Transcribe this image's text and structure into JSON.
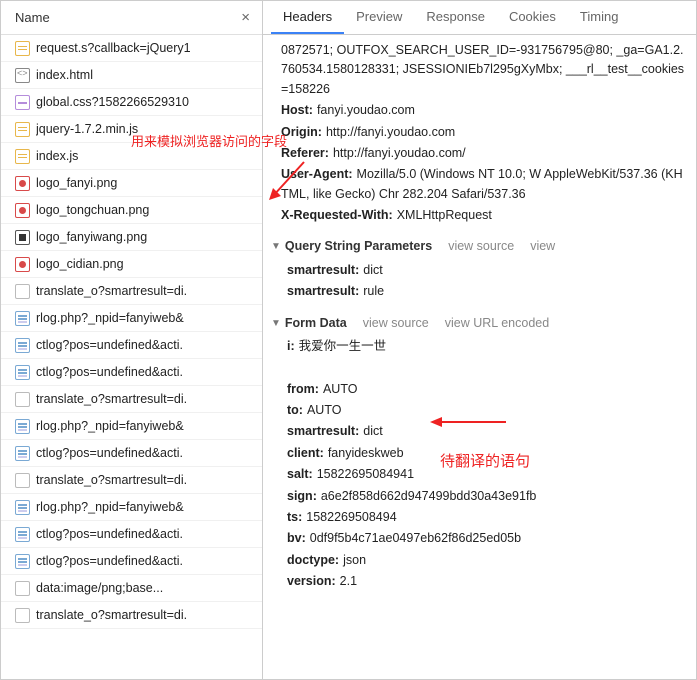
{
  "leftHeader": {
    "title": "Name"
  },
  "files": [
    {
      "icon": "js",
      "name": "request.s?callback=jQuery1"
    },
    {
      "icon": "html",
      "name": "index.html"
    },
    {
      "icon": "css",
      "name": "global.css?1582266529310"
    },
    {
      "icon": "js",
      "name": "jquery-1.7.2.min.js"
    },
    {
      "icon": "js",
      "name": "index.js"
    },
    {
      "icon": "png-r",
      "name": "logo_fanyi.png"
    },
    {
      "icon": "png-r",
      "name": "logo_tongchuan.png"
    },
    {
      "icon": "png-b",
      "name": "logo_fanyiwang.png"
    },
    {
      "icon": "png-r",
      "name": "logo_cidian.png"
    },
    {
      "icon": "plain",
      "name": "translate_o?smartresult=di."
    },
    {
      "icon": "net",
      "name": "rlog.php?_npid=fanyiweb&"
    },
    {
      "icon": "net",
      "name": "ctlog?pos=undefined&acti."
    },
    {
      "icon": "net",
      "name": "ctlog?pos=undefined&acti."
    },
    {
      "icon": "plain",
      "name": "translate_o?smartresult=di."
    },
    {
      "icon": "net",
      "name": "rlog.php?_npid=fanyiweb&"
    },
    {
      "icon": "net",
      "name": "ctlog?pos=undefined&acti."
    },
    {
      "icon": "plain",
      "name": "translate_o?smartresult=di."
    },
    {
      "icon": "net",
      "name": "rlog.php?_npid=fanyiweb&"
    },
    {
      "icon": "net",
      "name": "ctlog?pos=undefined&acti."
    },
    {
      "icon": "net",
      "name": "ctlog?pos=undefined&acti."
    },
    {
      "icon": "plain",
      "name": "data:image/png;base..."
    },
    {
      "icon": "plain",
      "name": "translate_o?smartresult=di."
    }
  ],
  "tabs": [
    {
      "label": "Headers",
      "active": true
    },
    {
      "label": "Preview",
      "active": false
    },
    {
      "label": "Response",
      "active": false
    },
    {
      "label": "Cookies",
      "active": false
    },
    {
      "label": "Timing",
      "active": false
    }
  ],
  "headers": {
    "cookieLine": "0872571; OUTFOX_SEARCH_USER_ID=-931756795@80; _ga=GA1.2.760534.1580128331; JSESSIONIEb7l295gXyMbx; ___rl__test__cookies=158226",
    "items": [
      {
        "k": "Host:",
        "v": "fanyi.youdao.com"
      },
      {
        "k": "Origin:",
        "v": "http://fanyi.youdao.com"
      },
      {
        "k": "Referer:",
        "v": "http://fanyi.youdao.com/"
      },
      {
        "k": "User-Agent:",
        "v": "Mozilla/5.0 (Windows NT 10.0; W AppleWebKit/537.36 (KHTML, like Gecko) Chr 282.204 Safari/537.36"
      },
      {
        "k": "X-Requested-With:",
        "v": "XMLHttpRequest"
      }
    ]
  },
  "query": {
    "title": "Query String Parameters",
    "viewSource": "view source",
    "viewEnc": "view",
    "items": [
      {
        "k": "smartresult:",
        "v": "dict"
      },
      {
        "k": "smartresult:",
        "v": "rule"
      }
    ]
  },
  "form": {
    "title": "Form Data",
    "viewSource": "view source",
    "viewEnc": "view URL encoded",
    "items": [
      {
        "k": "i:",
        "v": "我爱你一生一世"
      },
      {
        "k": "",
        "v": ""
      },
      {
        "k": "from:",
        "v": "AUTO"
      },
      {
        "k": "to:",
        "v": "AUTO"
      },
      {
        "k": "smartresult:",
        "v": "dict"
      },
      {
        "k": "client:",
        "v": "fanyideskweb"
      },
      {
        "k": "salt:",
        "v": "15822695084941"
      },
      {
        "k": "sign:",
        "v": "a6e2f858d662d947499bdd30a43e91fb"
      },
      {
        "k": "ts:",
        "v": "1582269508494"
      },
      {
        "k": "bv:",
        "v": "0df9f5b4c71ae0497eb62f86d25ed05b"
      },
      {
        "k": "doctype:",
        "v": "json"
      },
      {
        "k": "version:",
        "v": "2.1"
      }
    ]
  },
  "annotations": {
    "red1": "用来模拟浏览器访问的字段",
    "red2": "待翻译的语句"
  }
}
